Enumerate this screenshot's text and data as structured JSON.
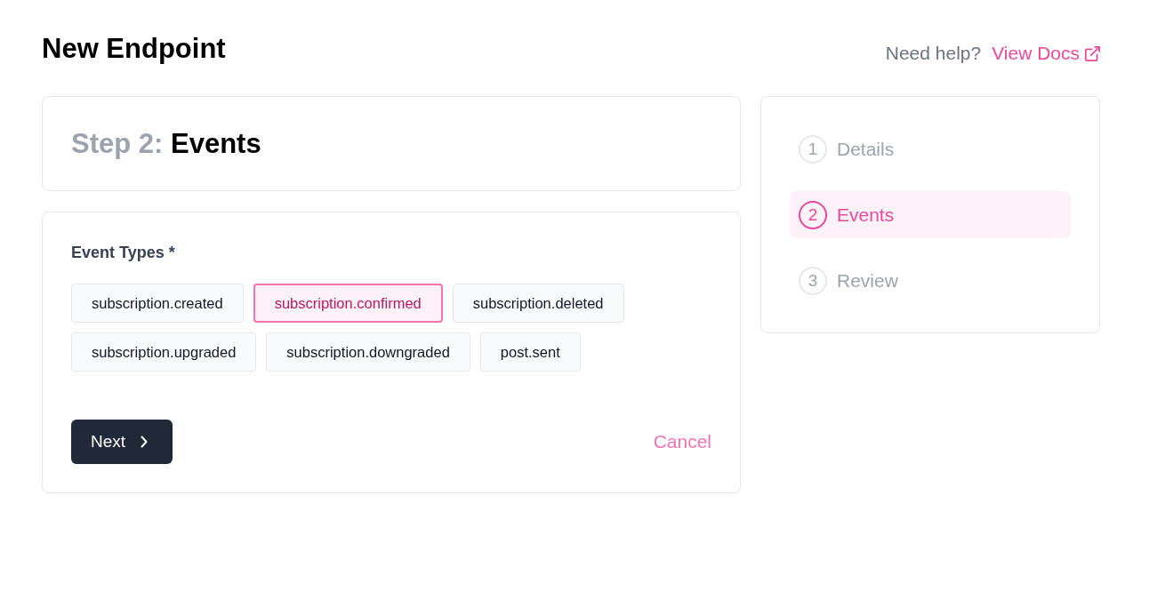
{
  "page": {
    "title": "New Endpoint"
  },
  "help": {
    "text": "Need help?",
    "link": "View Docs"
  },
  "step_header": {
    "step": "Step 2:",
    "title": "Events"
  },
  "event_types": {
    "label": "Event Types *",
    "options": [
      {
        "label": "subscription.created",
        "selected": false
      },
      {
        "label": "subscription.confirmed",
        "selected": true
      },
      {
        "label": "subscription.deleted",
        "selected": false
      },
      {
        "label": "subscription.upgraded",
        "selected": false
      },
      {
        "label": "subscription.downgraded",
        "selected": false
      },
      {
        "label": "post.sent",
        "selected": false
      }
    ]
  },
  "actions": {
    "next": "Next",
    "cancel": "Cancel"
  },
  "steps": [
    {
      "number": "1",
      "label": "Details",
      "selected": false
    },
    {
      "number": "2",
      "label": "Events",
      "selected": true
    },
    {
      "number": "3",
      "label": "Review",
      "selected": false
    }
  ]
}
